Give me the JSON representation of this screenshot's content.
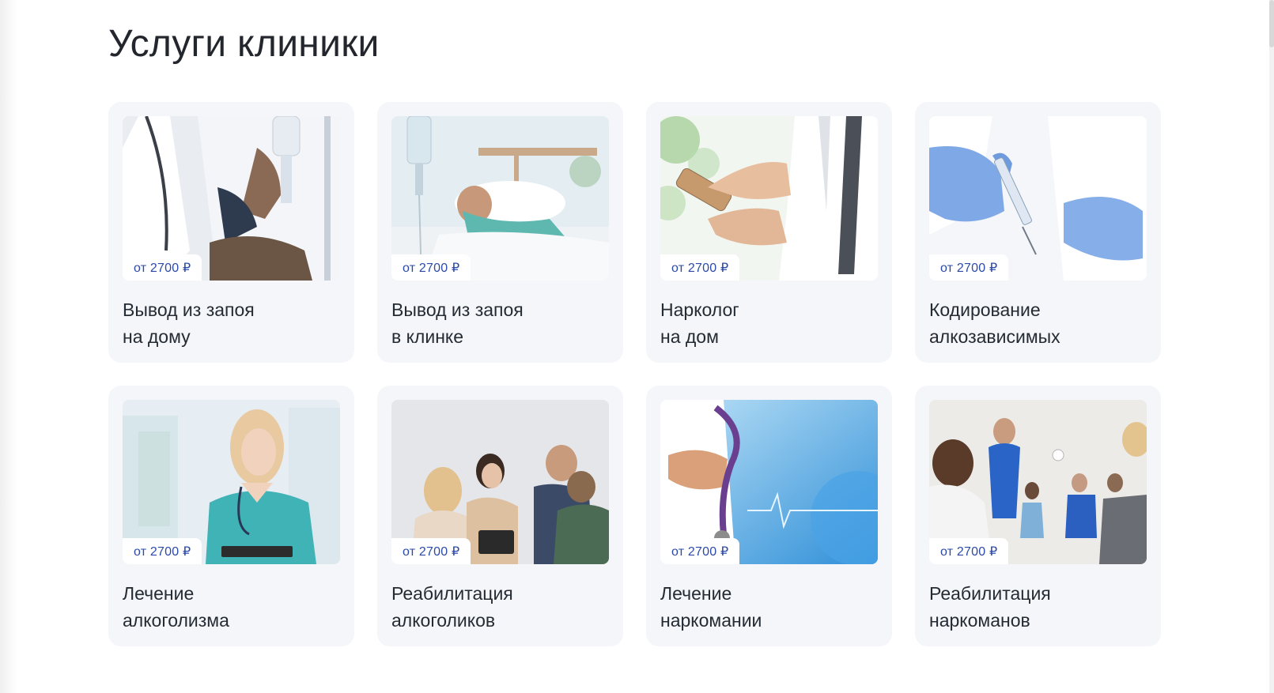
{
  "page": {
    "title": "Услуги клиники"
  },
  "services": [
    {
      "price": "от 2700 ₽",
      "line1": "Вывод из запоя",
      "line2": "на дому",
      "image": "doctor-iv-drip"
    },
    {
      "price": "от 2700 ₽",
      "line1": "Вывод из запоя",
      "line2": "в клинке",
      "image": "patient-hospital-bed"
    },
    {
      "price": "от 2700 ₽",
      "line1": "Нарколог",
      "line2": "на дом",
      "image": "doctor-smartphone"
    },
    {
      "price": "от 2700 ₽",
      "line1": "Кодирование",
      "line2": "алкозависимых",
      "image": "gloved-hands-syringe"
    },
    {
      "price": "от 2700 ₽",
      "line1": "Лечение",
      "line2": "алкоголизма",
      "image": "nurse-clipboard"
    },
    {
      "price": "от 2700 ₽",
      "line1": "Реабилитация",
      "line2": "алкоголиков",
      "image": "group-therapy-session"
    },
    {
      "price": "от 2700 ₽",
      "line1": "Лечение",
      "line2": "наркомании",
      "image": "doctor-stethoscope-globe"
    },
    {
      "price": "от 2700 ₽",
      "line1": "Реабилитация",
      "line2": "наркоманов",
      "image": "support-group-circle"
    }
  ],
  "colors": {
    "card_bg": "#f4f6fa",
    "price_text": "#2b4aa8",
    "heading": "#23272d"
  }
}
